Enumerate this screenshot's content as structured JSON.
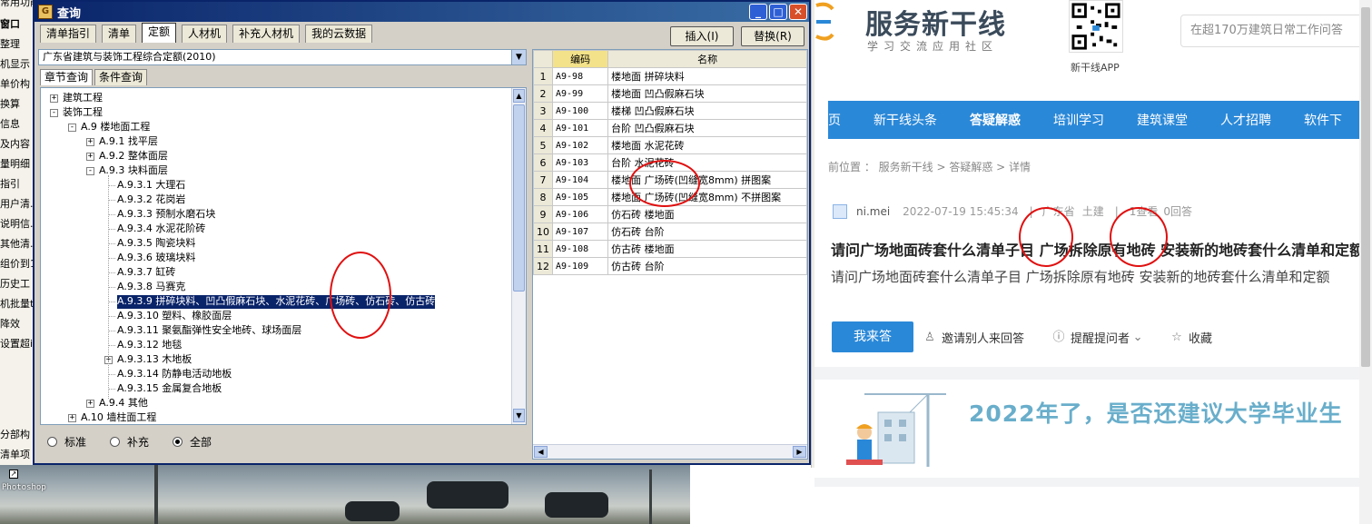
{
  "bg_app": {
    "left_items": [
      "窗口",
      "整理",
      "机显示",
      "单价构",
      "换算",
      "信息",
      "及内容",
      "量明细",
      "指引",
      "用户清.",
      "说明信.",
      "其他清.",
      "组价到1",
      "历史工",
      "机批量t",
      "降效",
      "设置超i"
    ],
    "bottom_items": [
      "分部构",
      "清单项"
    ],
    "photoshop_label": "Photoshop",
    "title_fragment": "常用功能"
  },
  "dialog": {
    "title": "查询",
    "tabs": [
      "清单指引",
      "清单",
      "定额",
      "人材机",
      "补充人材机",
      "我的云数据"
    ],
    "active_tab": "定额",
    "insert_button": "插入(I)",
    "replace_button": "替换(R)",
    "quota_library": "广东省建筑与装饰工程综合定额(2010)",
    "subtabs": [
      "章节查询",
      "条件查询"
    ],
    "tree": [
      {
        "label": "建筑工程",
        "level": 0,
        "expander": "+"
      },
      {
        "label": "装饰工程",
        "level": 0,
        "expander": "-"
      },
      {
        "label": "A.9  楼地面工程",
        "level": 1,
        "expander": "-"
      },
      {
        "label": "A.9.1  找平层",
        "level": 2,
        "expander": "+"
      },
      {
        "label": "A.9.2  整体面层",
        "level": 2,
        "expander": "+"
      },
      {
        "label": "A.9.3  块料面层",
        "level": 2,
        "expander": "-"
      },
      {
        "label": "A.9.3.1  大理石",
        "level": 3,
        "expander": ""
      },
      {
        "label": "A.9.3.2  花岗岩",
        "level": 3,
        "expander": ""
      },
      {
        "label": "A.9.3.3  预制水磨石块",
        "level": 3,
        "expander": ""
      },
      {
        "label": "A.9.3.4  水泥花阶砖",
        "level": 3,
        "expander": ""
      },
      {
        "label": "A.9.3.5  陶瓷块料",
        "level": 3,
        "expander": ""
      },
      {
        "label": "A.9.3.6  玻璃块料",
        "level": 3,
        "expander": ""
      },
      {
        "label": "A.9.3.7  缸砖",
        "level": 3,
        "expander": ""
      },
      {
        "label": "A.9.3.8  马赛克",
        "level": 3,
        "expander": ""
      },
      {
        "label": "A.9.3.9  拼碎块料、凹凸假麻石块、水泥花砖、广场砖、仿石砖、仿古砖",
        "level": 3,
        "expander": "",
        "selected": true
      },
      {
        "label": "A.9.3.10  塑料、橡胶面层",
        "level": 3,
        "expander": ""
      },
      {
        "label": "A.9.3.11  聚氨酯弹性安全地砖、球场面层",
        "level": 3,
        "expander": ""
      },
      {
        "label": "A.9.3.12  地毯",
        "level": 3,
        "expander": ""
      },
      {
        "label": "A.9.3.13  木地板",
        "level": 3,
        "expander": "+"
      },
      {
        "label": "A.9.3.14  防静电活动地板",
        "level": 3,
        "expander": ""
      },
      {
        "label": "A.9.3.15  金属复合地板",
        "level": 3,
        "expander": ""
      },
      {
        "label": "A.9.4  其他",
        "level": 2,
        "expander": "+"
      },
      {
        "label": "A.10  墙柱面工程",
        "level": 1,
        "expander": "+"
      }
    ],
    "radio_options": [
      "标准",
      "补充",
      "全部"
    ],
    "radio_selected": "全部",
    "grid_headers": [
      "编码",
      "名称"
    ],
    "grid_rows": [
      {
        "n": "1",
        "code": "A9-98",
        "name": "楼地面  拼碎块料"
      },
      {
        "n": "2",
        "code": "A9-99",
        "name": "楼地面  凹凸假麻石块"
      },
      {
        "n": "3",
        "code": "A9-100",
        "name": "楼梯  凹凸假麻石块"
      },
      {
        "n": "4",
        "code": "A9-101",
        "name": "台阶  凹凸假麻石块"
      },
      {
        "n": "5",
        "code": "A9-102",
        "name": "楼地面  水泥花砖"
      },
      {
        "n": "6",
        "code": "A9-103",
        "name": "台阶  水泥花砖"
      },
      {
        "n": "7",
        "code": "A9-104",
        "name": "楼地面  广场砖(凹缝宽8mm) 拼图案"
      },
      {
        "n": "8",
        "code": "A9-105",
        "name": "楼地面  广场砖(凹缝宽8mm) 不拼图案"
      },
      {
        "n": "9",
        "code": "A9-106",
        "name": "仿石砖  楼地面"
      },
      {
        "n": "10",
        "code": "A9-107",
        "name": "仿石砖  台阶"
      },
      {
        "n": "11",
        "code": "A9-108",
        "name": "仿古砖  楼地面"
      },
      {
        "n": "12",
        "code": "A9-109",
        "name": "仿古砖  台阶"
      }
    ]
  },
  "web": {
    "logo_text": "服务新干线",
    "logo_subtitle": "学习交流应用社区",
    "qr_label": "新干线APP",
    "search_placeholder": "在超170万建筑日常工作问答",
    "nav": [
      "页",
      "新干线头条",
      "答疑解惑",
      "培训学习",
      "建筑课堂",
      "人才招聘",
      "软件下"
    ],
    "nav_active": "答疑解惑",
    "breadcrumb": "前位置 ： 服务新干线 > 答疑解惑 > 详情",
    "author": "ni.mei",
    "date": "2022-07-19 15:45:34",
    "region": "广东省",
    "category": "土建",
    "views": "1查看",
    "answers": "0回答",
    "question_title": "请问广场地面砖套什么清单子目 广场拆除原有地砖 安装新的地砖套什么清单和定额",
    "question_body": "请问广场地面砖套什么清单子目 广场拆除原有地砖 安装新的地砖套什么清单和定额",
    "answer_button": "我来答",
    "invite_label": "邀请别人来回答",
    "remind_label": "提醒提问者",
    "favorite_label": "收藏",
    "banner_text": "2022年了，是否还建议大学毕业生"
  },
  "colors": {
    "title_bar": "#0a246a",
    "selection": "#0a246a",
    "web_accent": "#2a88d8",
    "annotation_circle": "#e01010"
  }
}
